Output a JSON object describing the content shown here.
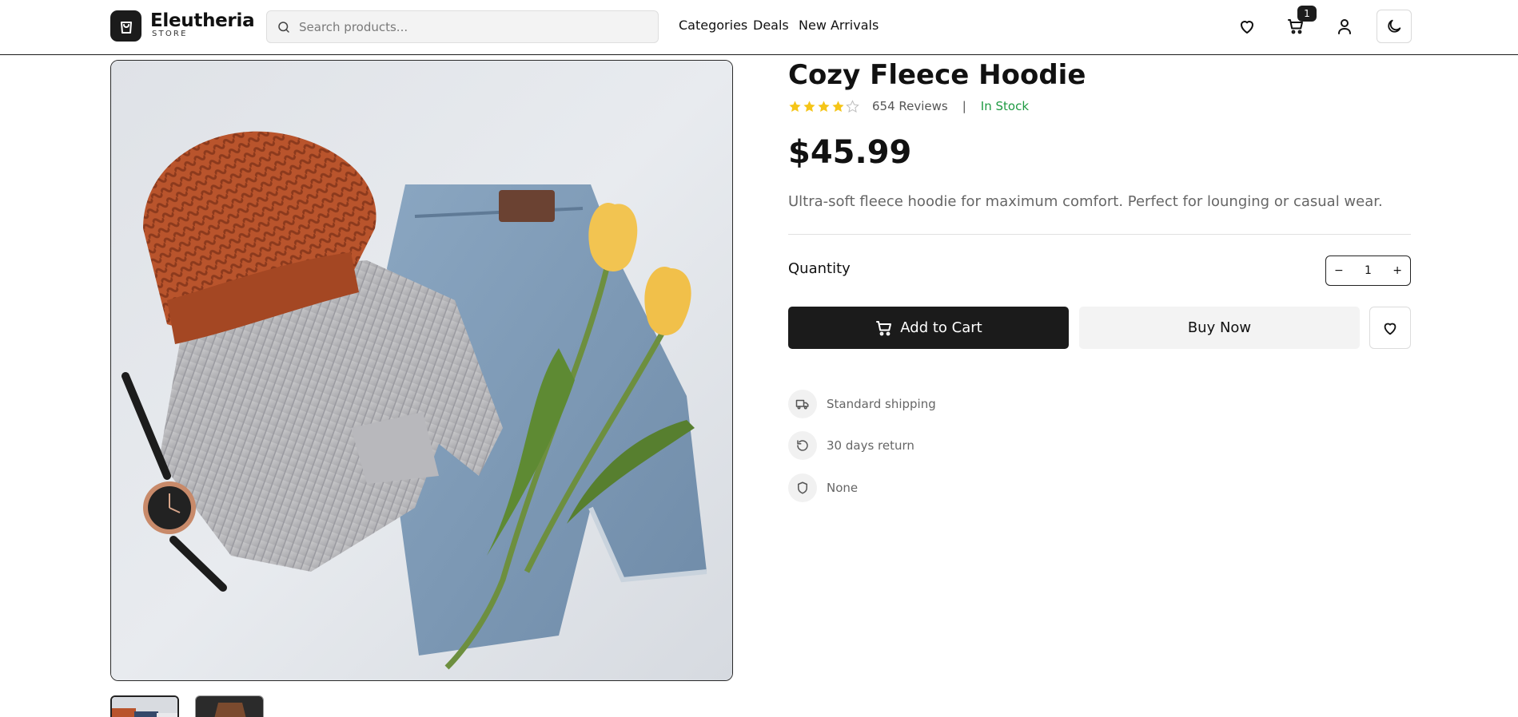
{
  "brand": {
    "name": "Eleutheria",
    "tagline": "STORE"
  },
  "search": {
    "placeholder": "Search products..."
  },
  "nav": {
    "categories": "Categories",
    "deals": "Deals",
    "new_arrivals": "New Arrivals"
  },
  "header_icons": {
    "wishlist": "heart-icon",
    "cart": "cart-icon",
    "account": "user-icon",
    "theme": "moon-icon"
  },
  "cart": {
    "count": "1"
  },
  "product": {
    "title": "Cozy Fleece Hoodie",
    "rating": 4,
    "rating_max": 5,
    "reviews": "654 Reviews",
    "separator": "|",
    "stock": "In Stock",
    "price": "$45.99",
    "description": "Ultra-soft fleece hoodie for maximum comfort. Perfect for lounging or casual wear.",
    "quantity_label": "Quantity",
    "quantity": "1",
    "decrement": "−",
    "increment": "+",
    "add_to_cart": "Add to Cart",
    "buy_now": "Buy Now"
  },
  "features": [
    {
      "icon": "truck-icon",
      "label": "Standard shipping"
    },
    {
      "icon": "return-icon",
      "label": "30 days return"
    },
    {
      "icon": "shield-icon",
      "label": "None"
    }
  ],
  "colors": {
    "primary": "#1b1b1b",
    "accent_star": "#f5c518",
    "stock_green": "#1e9a42",
    "muted_text": "#666666"
  }
}
